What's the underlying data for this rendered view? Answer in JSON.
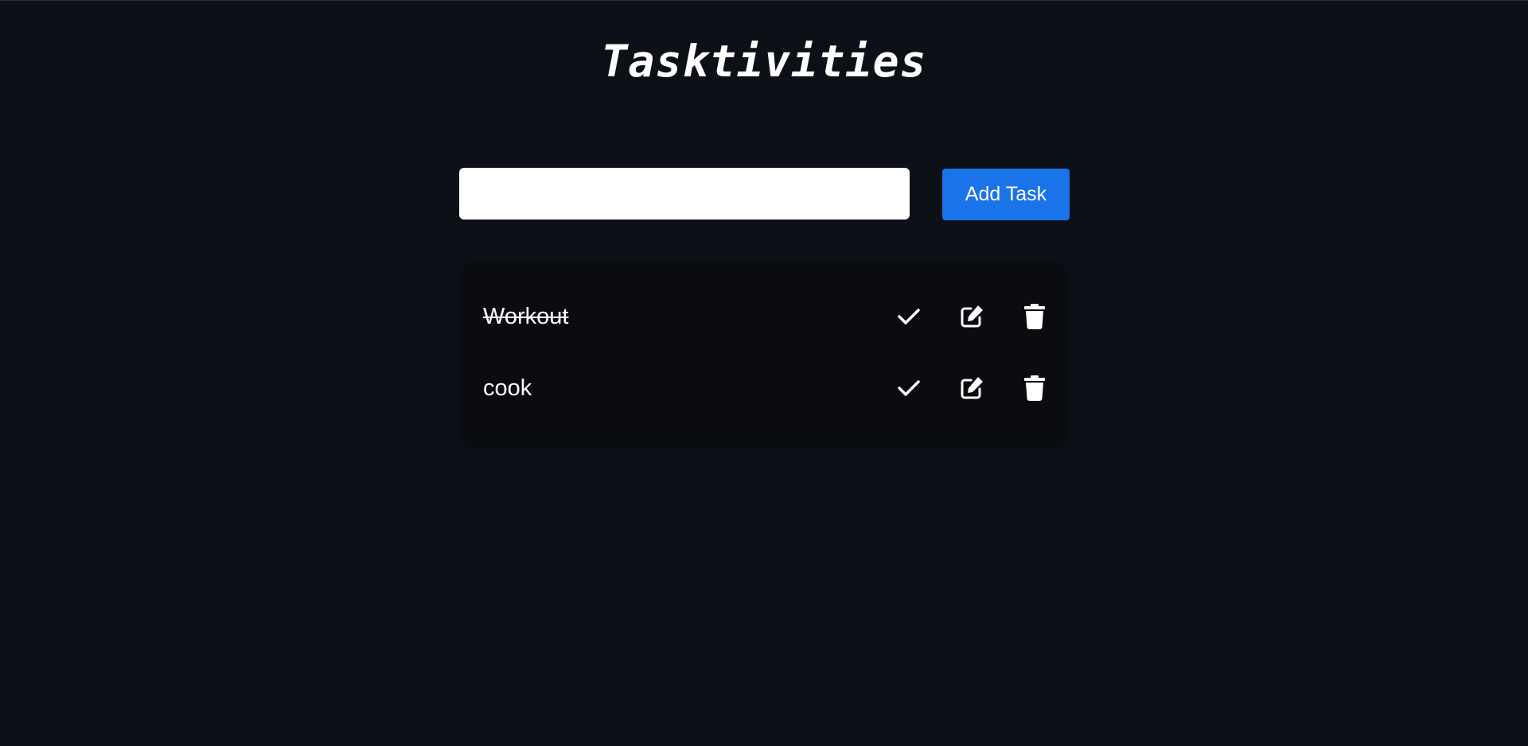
{
  "app": {
    "title": "Tasktivities"
  },
  "form": {
    "input_value": "",
    "input_placeholder": "",
    "add_button_label": "Add Task"
  },
  "tasks": [
    {
      "text": "Workout",
      "completed": true
    },
    {
      "text": "cook",
      "completed": false
    }
  ],
  "icons": {
    "complete": "check-icon",
    "edit": "edit-icon",
    "delete": "trash-icon"
  },
  "colors": {
    "background": "#0d1117",
    "card": "#0a0c0f",
    "accent": "#1a73e8",
    "text": "#ffffff"
  }
}
